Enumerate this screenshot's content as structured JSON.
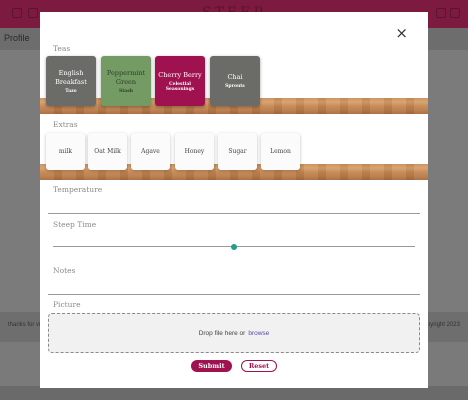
{
  "app": {
    "title": "STEEP",
    "subheader": "Profile",
    "footer_left": "thanks for vis",
    "footer_right": "copyright 2023"
  },
  "modal": {
    "close_icon": "×",
    "teas_label": "Teas",
    "teas": [
      {
        "name": "English Breakfast",
        "sub": "Tazo",
        "color": "#6b6b67",
        "text_color": "#ffffff"
      },
      {
        "name": "Peppermint Green",
        "sub": "Stash",
        "color": "#739b63",
        "text_color": "#2f3f2a"
      },
      {
        "name": "Cherry Berry",
        "sub": "Celestial Seasonings",
        "color": "#a0124f",
        "text_color": "#ffffff"
      },
      {
        "name": "Chai",
        "sub": "Sprouts",
        "color": "#6b6b67",
        "text_color": "#ffffff"
      }
    ],
    "extras_label": "Extras",
    "extras": [
      "milk",
      "Oat Milk",
      "Agave",
      "Honey",
      "Sugar",
      "Lemon"
    ],
    "temperature_label": "Temperature",
    "temperature_value": "",
    "steep_time_label": "Steep Time",
    "steep_time_value": 0.5,
    "notes_label": "Notes",
    "notes_value": "",
    "picture_label": "Picture",
    "dropzone_text": "Drop file here or",
    "dropzone_link": "browse",
    "submit_label": "Submit",
    "reset_label": "Reset"
  },
  "colors": {
    "accent": "#a0124f",
    "slider": "#1f9e8c",
    "link": "#5b4ab0"
  }
}
